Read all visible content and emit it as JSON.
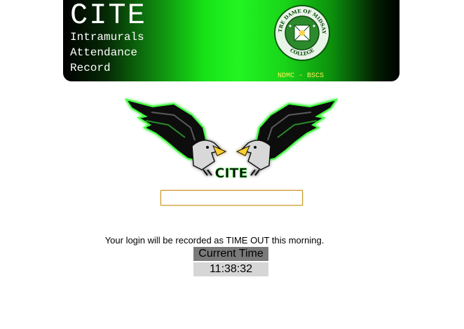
{
  "banner": {
    "title": "CITE",
    "subtitle_lines": [
      "Intramurals",
      "Attendance",
      "Record"
    ],
    "tag": "NDMC - BSCS",
    "seal_top_text": "NOTRE DAME OF MIDSAYAP",
    "seal_bottom_text": "COLLEGE"
  },
  "logo": {
    "text": "CITE",
    "icon": "twin-eagles-logo"
  },
  "input": {
    "value": "",
    "placeholder": ""
  },
  "status": {
    "message": "Your login will be recorded as TIME OUT this morning.",
    "current_time_label": "Current Time",
    "current_time_value": "11:38:32"
  },
  "colors": {
    "banner_green": "#22f522",
    "input_border": "#c89a2a",
    "label_bg": "#7a7a7a",
    "time_bg": "#d6d6d6"
  }
}
